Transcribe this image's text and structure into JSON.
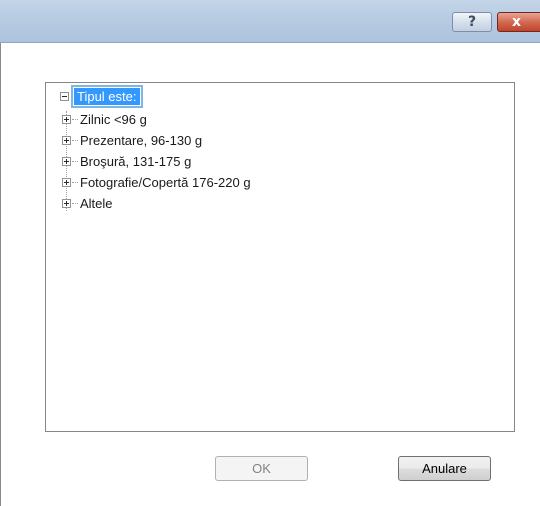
{
  "title_bar": {
    "help_glyph": "?",
    "close_glyph": "x"
  },
  "tree": {
    "root": {
      "label": "Tipul este:",
      "expanded": true,
      "selected": true
    },
    "children": [
      {
        "label": "Zilnic <96 g",
        "expanded": false
      },
      {
        "label": "Prezentare, 96-130 g",
        "expanded": false
      },
      {
        "label": "Broşură, 131-175 g",
        "expanded": false
      },
      {
        "label": "Fotografie/Copertă 176-220 g",
        "expanded": false
      },
      {
        "label": "Altele",
        "expanded": false
      }
    ]
  },
  "buttons": {
    "ok_label": "OK",
    "ok_enabled": false,
    "cancel_label": "Anulare"
  },
  "colors": {
    "selection": "#3399ff",
    "titlebar": "#b7cbe2",
    "close": "#c2432b"
  }
}
